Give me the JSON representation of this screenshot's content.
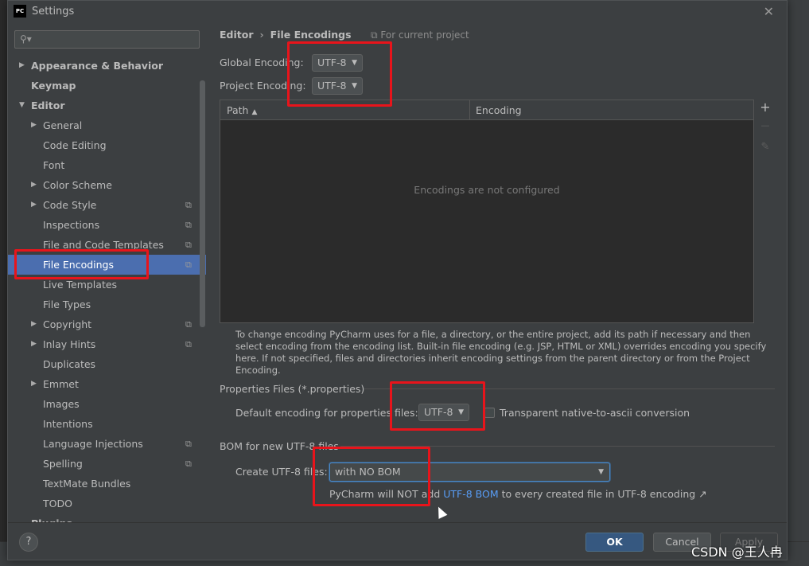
{
  "window": {
    "title": "Settings",
    "app_badge": "PC",
    "close_glyph": "✕"
  },
  "search": {
    "placeholder": "",
    "icon": "search-icon"
  },
  "sidebar": {
    "items": [
      {
        "label": "Appearance & Behavior",
        "level": 0,
        "bold": true,
        "arrow": "▶",
        "copy": false,
        "selected": false
      },
      {
        "label": "Keymap",
        "level": 0,
        "bold": true,
        "arrow": "",
        "copy": false,
        "selected": false
      },
      {
        "label": "Editor",
        "level": 0,
        "bold": true,
        "arrow": "▼",
        "copy": false,
        "selected": false
      },
      {
        "label": "General",
        "level": 1,
        "bold": false,
        "arrow": "▶",
        "copy": false,
        "selected": false
      },
      {
        "label": "Code Editing",
        "level": 1,
        "bold": false,
        "arrow": "",
        "copy": false,
        "selected": false
      },
      {
        "label": "Font",
        "level": 1,
        "bold": false,
        "arrow": "",
        "copy": false,
        "selected": false
      },
      {
        "label": "Color Scheme",
        "level": 1,
        "bold": false,
        "arrow": "▶",
        "copy": false,
        "selected": false
      },
      {
        "label": "Code Style",
        "level": 1,
        "bold": false,
        "arrow": "▶",
        "copy": true,
        "selected": false
      },
      {
        "label": "Inspections",
        "level": 1,
        "bold": false,
        "arrow": "",
        "copy": true,
        "selected": false
      },
      {
        "label": "File and Code Templates",
        "level": 1,
        "bold": false,
        "arrow": "",
        "copy": true,
        "selected": false
      },
      {
        "label": "File Encodings",
        "level": 1,
        "bold": false,
        "arrow": "",
        "copy": true,
        "selected": true
      },
      {
        "label": "Live Templates",
        "level": 1,
        "bold": false,
        "arrow": "",
        "copy": false,
        "selected": false
      },
      {
        "label": "File Types",
        "level": 1,
        "bold": false,
        "arrow": "",
        "copy": false,
        "selected": false
      },
      {
        "label": "Copyright",
        "level": 1,
        "bold": false,
        "arrow": "▶",
        "copy": true,
        "selected": false
      },
      {
        "label": "Inlay Hints",
        "level": 1,
        "bold": false,
        "arrow": "▶",
        "copy": true,
        "selected": false
      },
      {
        "label": "Duplicates",
        "level": 1,
        "bold": false,
        "arrow": "",
        "copy": false,
        "selected": false
      },
      {
        "label": "Emmet",
        "level": 1,
        "bold": false,
        "arrow": "▶",
        "copy": false,
        "selected": false
      },
      {
        "label": "Images",
        "level": 1,
        "bold": false,
        "arrow": "",
        "copy": false,
        "selected": false
      },
      {
        "label": "Intentions",
        "level": 1,
        "bold": false,
        "arrow": "",
        "copy": false,
        "selected": false
      },
      {
        "label": "Language Injections",
        "level": 1,
        "bold": false,
        "arrow": "",
        "copy": true,
        "selected": false
      },
      {
        "label": "Spelling",
        "level": 1,
        "bold": false,
        "arrow": "",
        "copy": true,
        "selected": false
      },
      {
        "label": "TextMate Bundles",
        "level": 1,
        "bold": false,
        "arrow": "",
        "copy": false,
        "selected": false
      },
      {
        "label": "TODO",
        "level": 1,
        "bold": false,
        "arrow": "",
        "copy": false,
        "selected": false
      },
      {
        "label": "Plugins",
        "level": 0,
        "bold": true,
        "arrow": "",
        "copy": false,
        "selected": false
      }
    ]
  },
  "breadcrumb": {
    "parent": "Editor",
    "separator": "›",
    "current": "File Encodings"
  },
  "scope": {
    "icon": "copy-icon",
    "glyph": "⧉",
    "label": "For current project"
  },
  "global_encoding": {
    "label": "Global Encoding:",
    "value": "UTF-8"
  },
  "project_encoding": {
    "label": "Project Encoding:",
    "value": "UTF-8"
  },
  "table": {
    "columns": [
      {
        "label": "Path",
        "sort": "▲"
      },
      {
        "label": "Encoding",
        "sort": ""
      }
    ],
    "empty_text": "Encodings are not configured",
    "tools": [
      {
        "glyph": "+",
        "name": "add-icon"
      },
      {
        "glyph": "—",
        "name": "remove-icon"
      },
      {
        "glyph": "✎",
        "name": "edit-icon"
      }
    ]
  },
  "help_text": "To change encoding PyCharm uses for a file, a directory, or the entire project, add its path if necessary and then select encoding from the encoding list. Built-in file encoding (e.g. JSP, HTML or XML) overrides encoding you specify here. If not specified, files and directories inherit encoding settings from the parent directory or from the Project Encoding.",
  "properties": {
    "section_title": "Properties Files (*.properties)",
    "default_label": "Default encoding for properties files:",
    "default_value": "UTF-8",
    "transparent_label": "Transparent native-to-ascii conversion",
    "transparent_checked": false
  },
  "bom": {
    "section_title": "BOM for new UTF-8 files",
    "create_label": "Create UTF-8 files:",
    "create_value": "with NO BOM",
    "note_prefix": "PyCharm will NOT add ",
    "note_link": "UTF-8 BOM",
    "note_suffix": " to every created file in UTF-8 encoding ↗"
  },
  "footer": {
    "help": "?",
    "ok": "OK",
    "cancel": "Cancel",
    "apply": "Apply"
  },
  "overlay": {
    "watermark": "CSDN @王人冉",
    "highlight_color": "#e8141b"
  },
  "colors": {
    "selection": "#4b6eaf",
    "link": "#589df6",
    "ok_button": "#365880",
    "focus_border": "#4a88c7"
  }
}
